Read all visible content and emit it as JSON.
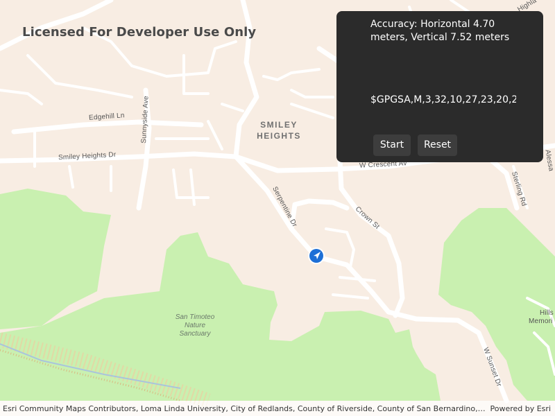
{
  "map": {
    "watermark": "Licensed For Developer Use Only",
    "neighborhood": [
      "SMILEY",
      "HEIGHTS"
    ],
    "park": [
      "San Timoteo",
      "Nature",
      "Sanctuary"
    ],
    "streets": {
      "edgehill": "Edgehill Ln",
      "sunnyside": "Sunnyside Ave",
      "smiley_heights": "Smiley Heights Dr",
      "crescent": "W Crescent Av",
      "serpentine": "Serpentine Dr",
      "crown": "Crown St",
      "sterling": "Sterling Rd",
      "sunset": "W Sunset Dr",
      "alessandro": "Alessa",
      "highland": "Highla",
      "hills": "Hills",
      "memorial": "Memori"
    },
    "location_icon": "navigation-arrow-icon",
    "colors": {
      "land": "#f8ede3",
      "park": "#c9f0b0",
      "road": "#ffffff",
      "panel": "#2b2b2b",
      "location": "#1d6fd6"
    }
  },
  "panel": {
    "accuracy": "Accuracy: Horizontal 4.70 meters, Vertical  7.52 meters",
    "nmea": "$GPGSA,M,3,32,10,27,23,20,2...",
    "start_label": "Start",
    "reset_label": "Reset"
  },
  "attribution": {
    "text": "Esri Community Maps Contributors, Loma Linda University, City of Redlands, County of Riverside, County of San Bernardino, California State Parks, Esri, HERE, Garmin, SafeGraph, METI/NASA, USGS, Bureau of Land Management, EPA, NPS, USDA",
    "powered_by": "Powered by Esri"
  }
}
